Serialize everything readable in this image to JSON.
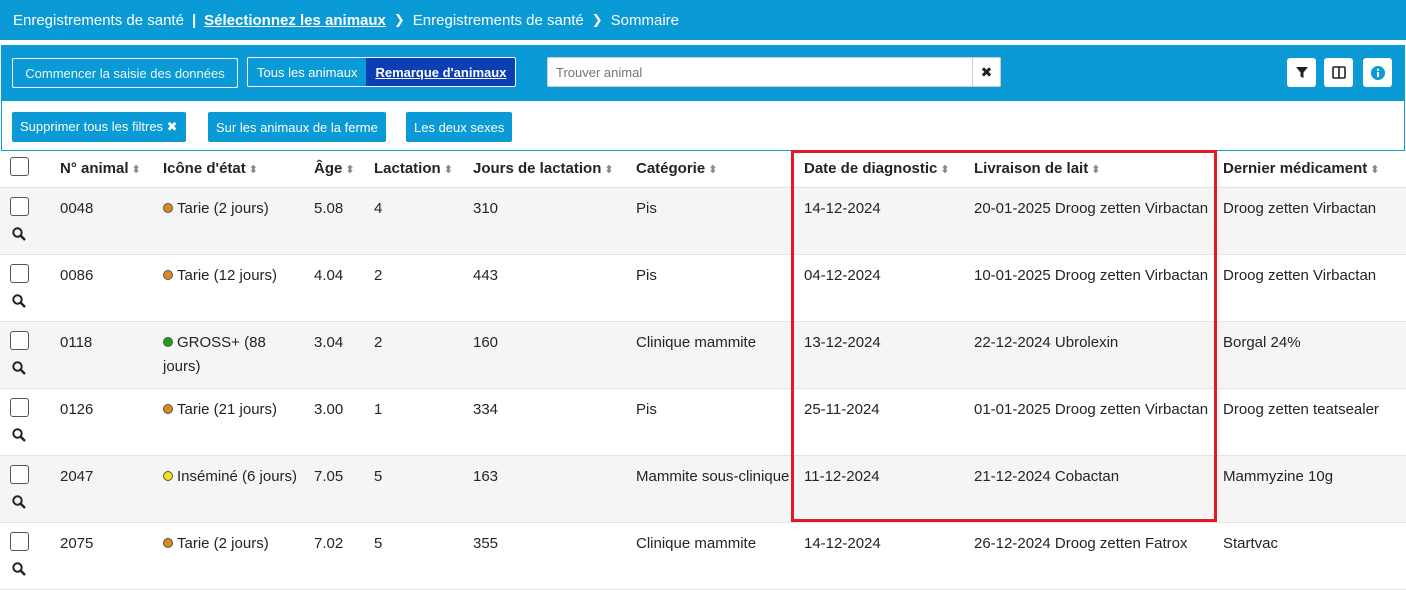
{
  "breadcrumb": {
    "items": [
      "Enregistrements de santé",
      "Sélectionnez les animaux",
      "Enregistrements de santé",
      "Sommaire"
    ],
    "separator": "|",
    "chevron": "❯"
  },
  "toolbar": {
    "start_label": "Commencer la saisie des données",
    "segment": {
      "all": "Tous les animaux",
      "remark": "Remarque d'animaux"
    },
    "search_placeholder": "Trouver animal",
    "clear_glyph": "✖",
    "icons": [
      "filter-icon",
      "columns-icon",
      "info-icon"
    ]
  },
  "filters": {
    "remove_all": "Supprimer tous les filtres ✖",
    "farm": "Sur les animaux de la ferme",
    "sexes": "Les deux sexes"
  },
  "table": {
    "headers": [
      "N° animal",
      "Icône d'état",
      "Âge",
      "Lactation",
      "Jours de lactation",
      "Catégorie",
      "Date de diagnostic",
      "Livraison de lait",
      "Dernier médicament"
    ],
    "sort_glyph": "⬍",
    "rows": [
      {
        "id": "0048",
        "status": "Tarie (2 jours)",
        "dot": "#d98a1f",
        "age": "5.08",
        "lact": "4",
        "days": "310",
        "cat": "Pis",
        "diag": "14-12-2024",
        "milk": "20-01-2025 Droog zetten Virbactan",
        "med": "Droog zetten Virbactan"
      },
      {
        "id": "0086",
        "status": "Tarie (12 jours)",
        "dot": "#d98a1f",
        "age": "4.04",
        "lact": "2",
        "days": "443",
        "cat": "Pis",
        "diag": "04-12-2024",
        "milk": "10-01-2025 Droog zetten Virbactan",
        "med": "Droog zetten Virbactan"
      },
      {
        "id": "0118",
        "status": "GROSS+ (88 jours)",
        "dot": "#1e9e1e",
        "age": "3.04",
        "lact": "2",
        "days": "160",
        "cat": "Clinique mammite",
        "diag": "13-12-2024",
        "milk": "22-12-2024 Ubrolexin",
        "med": "Borgal 24%"
      },
      {
        "id": "0126",
        "status": "Tarie (21 jours)",
        "dot": "#d98a1f",
        "age": "3.00",
        "lact": "1",
        "days": "334",
        "cat": "Pis",
        "diag": "25-11-2024",
        "milk": "01-01-2025 Droog zetten Virbactan",
        "med": "Droog zetten teatsealer"
      },
      {
        "id": "2047",
        "status": "Inséminé (6 jours)",
        "dot": "#f3e21a",
        "age": "7.05",
        "lact": "5",
        "days": "163",
        "cat": "Mammite sous-clinique",
        "diag": "11-12-2024",
        "milk": "21-12-2024 Cobactan",
        "med": "Mammyzine 10g"
      },
      {
        "id": "2075",
        "status": "Tarie (2 jours)",
        "dot": "#d98a1f",
        "age": "7.02",
        "lact": "5",
        "days": "355",
        "cat": "Clinique mammite",
        "diag": "14-12-2024",
        "milk": "26-12-2024 Droog zetten Fatrox",
        "med": "Startvac"
      }
    ]
  },
  "colors": {
    "primary": "#0a9ad6",
    "active_segment": "#0b3fb3",
    "highlight": "#e21a23"
  }
}
